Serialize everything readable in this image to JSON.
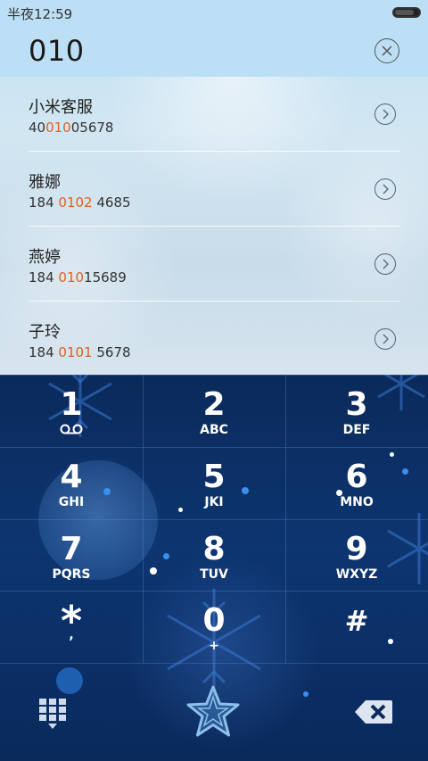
{
  "status_bar": {
    "time": "半夜12:59",
    "battery_level_percent": 80
  },
  "dial": {
    "number": "010"
  },
  "contacts": [
    {
      "name": "小米客服",
      "number_before": "40",
      "number_match": "010",
      "number_after": "05678"
    },
    {
      "name": "雅娜",
      "number_before": "184 ",
      "number_match": "0102",
      "number_after": " 4685"
    },
    {
      "name": "燕婷",
      "number_before": "184 ",
      "number_match": "010",
      "number_after": "15689"
    },
    {
      "name": "子玲",
      "number_before": "184 ",
      "number_match": "0101",
      "number_after": " 5678"
    }
  ],
  "keypad": {
    "keys": [
      {
        "digit": "1",
        "letters": ""
      },
      {
        "digit": "2",
        "letters": "ABC"
      },
      {
        "digit": "3",
        "letters": "DEF"
      },
      {
        "digit": "4",
        "letters": "GHI"
      },
      {
        "digit": "5",
        "letters": "JKI"
      },
      {
        "digit": "6",
        "letters": "MNO"
      },
      {
        "digit": "7",
        "letters": "PQRS"
      },
      {
        "digit": "8",
        "letters": "TUV"
      },
      {
        "digit": "9",
        "letters": "WXYZ"
      },
      {
        "digit": "*",
        "letters": ","
      },
      {
        "digit": "0",
        "letters": "+"
      },
      {
        "digit": "#",
        "letters": ""
      }
    ]
  },
  "icons": {
    "clear": "clear-circle-x-icon",
    "contact_detail": "chevron-right-circle-icon",
    "voicemail": "voicemail-icon",
    "keypad_toggle": "keypad-grid-icon",
    "call": "star-call-icon",
    "delete": "backspace-icon"
  },
  "colors": {
    "highlight": "#e2601e",
    "header_bg": "#bcdff6",
    "keypad_bg": "#0b2a5b"
  }
}
